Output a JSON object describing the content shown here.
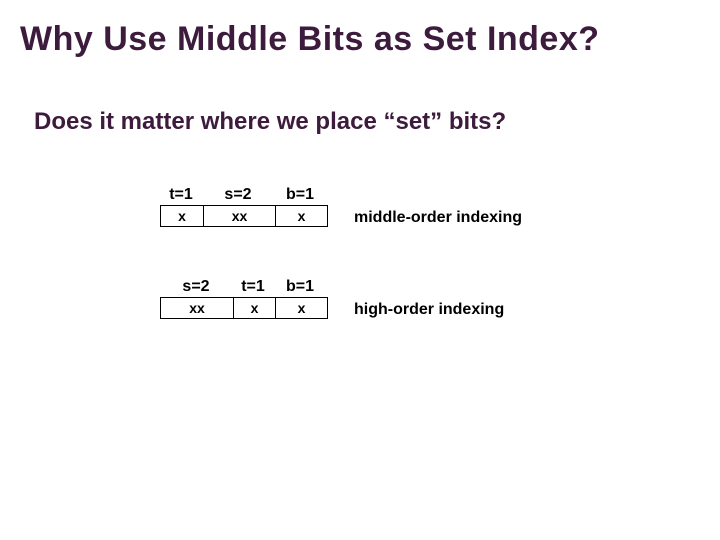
{
  "title": "Why Use Middle Bits as Set Index?",
  "subtitle": "Does it matter where we place “set” bits?",
  "rows": [
    {
      "labels": [
        "t=1",
        "s=2",
        "b=1"
      ],
      "cells": [
        "x",
        "xx",
        "x"
      ],
      "caption": "middle-order indexing"
    },
    {
      "labels": [
        "s=2",
        "t=1",
        "b=1"
      ],
      "cells": [
        "xx",
        "x",
        "x"
      ],
      "caption": "high-order indexing"
    }
  ]
}
